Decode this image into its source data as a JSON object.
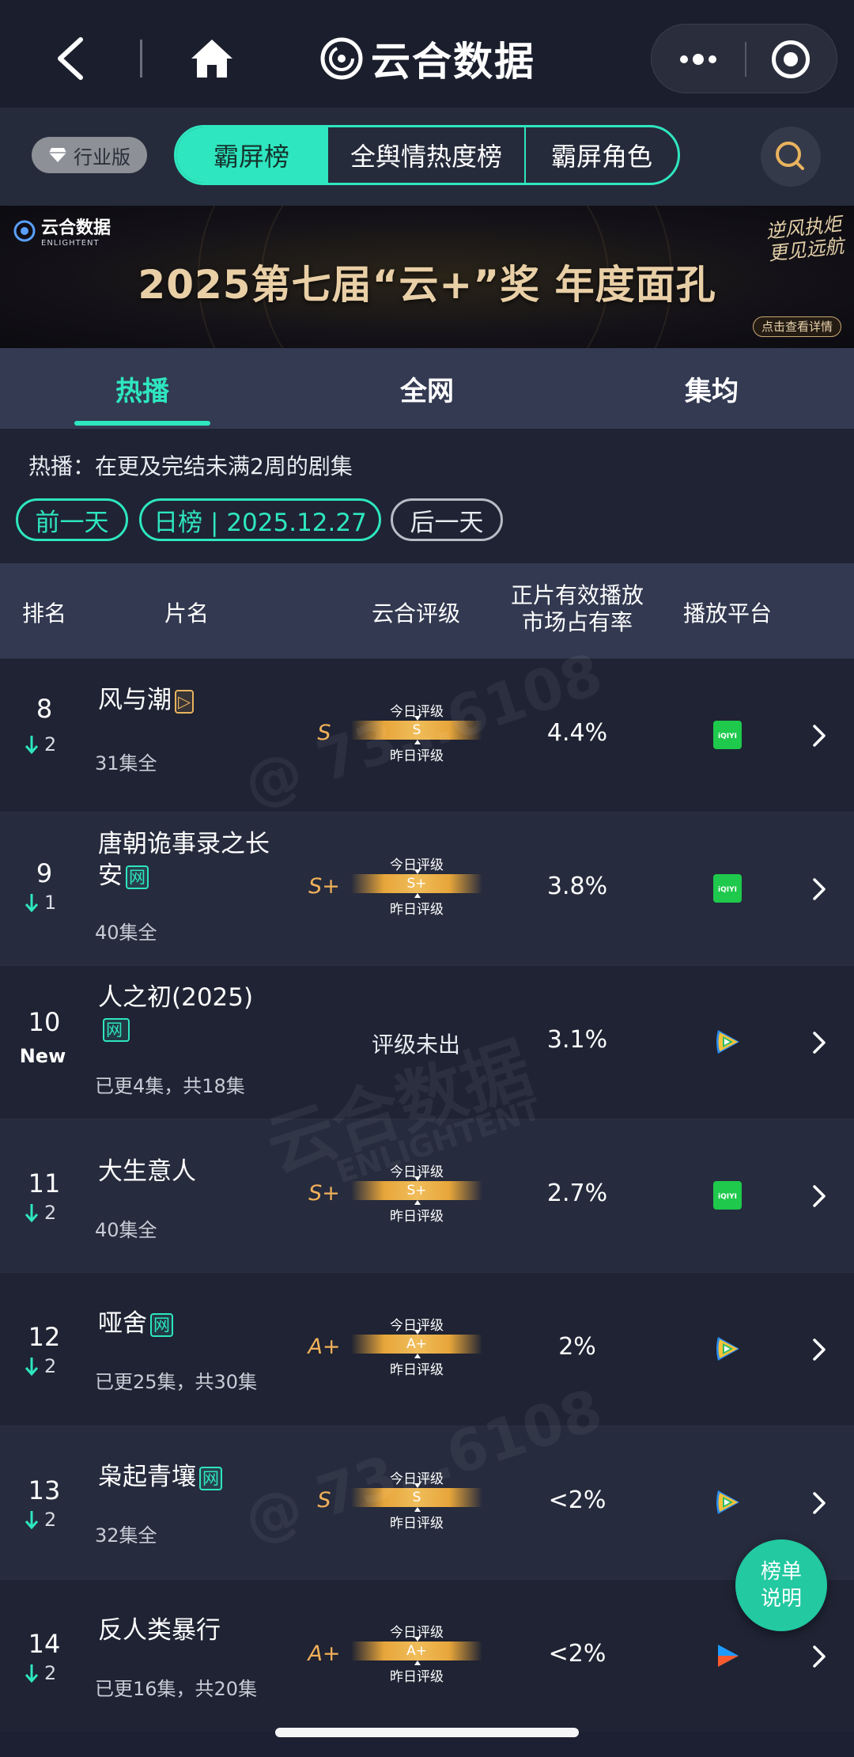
{
  "nav": {
    "brand": "云合数据"
  },
  "filter": {
    "edition_label": "行业版",
    "segments": [
      {
        "label": "霸屏榜",
        "active": true
      },
      {
        "label": "全舆情热度榜",
        "active": false
      },
      {
        "label": "霸屏角色",
        "active": false
      }
    ]
  },
  "banner": {
    "logo_name": "云合数据",
    "logo_sub": "ENLIGHTENT",
    "title": "2025第七届“云+”奖  年度面孔",
    "script_line1": "逆风执炬",
    "script_line2": "更见远航",
    "cta": "点击查看详情"
  },
  "tabs": [
    {
      "label": "热播",
      "active": true
    },
    {
      "label": "全网",
      "active": false
    },
    {
      "label": "集均",
      "active": false
    }
  ],
  "desc": "热播：在更及完结未满2周的剧集",
  "date_controls": {
    "prev": "前一天",
    "current": "日榜 | 2025.12.27",
    "next": "后一天"
  },
  "table_header": {
    "rank": "排名",
    "title": "片名",
    "grade": "云合评级",
    "share_line1": "正片有效播放",
    "share_line2": "市场占有率",
    "platform": "播放平台"
  },
  "grade_labels": {
    "today": "今日评级",
    "yesterday": "昨日评级",
    "none": "评级未出"
  },
  "rows": [
    {
      "rank": "8",
      "change": "2",
      "direction": "down",
      "title": "风与潮",
      "tag": "play",
      "sub": "31集全",
      "grade": "S",
      "grade_today": "S",
      "share": "4.4%",
      "platform": "iqiyi"
    },
    {
      "rank": "9",
      "change": "1",
      "direction": "down",
      "title": "唐朝诡事录之长安",
      "tag": "网",
      "sub": "40集全",
      "grade": "S+",
      "grade_today": "S+",
      "share": "3.8%",
      "platform": "iqiyi"
    },
    {
      "rank": "10",
      "change": "New",
      "direction": "new",
      "title": "人之初(2025)",
      "tag": "网",
      "sub": "已更4集，共18集",
      "grade": "",
      "grade_today": "",
      "share": "3.1%",
      "platform": "tencent"
    },
    {
      "rank": "11",
      "change": "2",
      "direction": "down",
      "title": "大生意人",
      "tag": "",
      "sub": "40集全",
      "grade": "S+",
      "grade_today": "S+",
      "share": "2.7%",
      "platform": "iqiyi"
    },
    {
      "rank": "12",
      "change": "2",
      "direction": "down",
      "title": "哑舍",
      "tag": "网",
      "sub": "已更25集，共30集",
      "grade": "A+",
      "grade_today": "A+",
      "share": "2%",
      "platform": "tencent"
    },
    {
      "rank": "13",
      "change": "2",
      "direction": "down",
      "title": "枭起青壤",
      "tag": "网",
      "sub": "32集全",
      "grade": "S",
      "grade_today": "S",
      "share": "<2%",
      "platform": "tencent"
    },
    {
      "rank": "14",
      "change": "2",
      "direction": "down",
      "title": "反人类暴行",
      "tag": "",
      "sub": "已更16集，共20集",
      "grade": "A+",
      "grade_today": "A+",
      "share": "<2%",
      "platform": "youku"
    }
  ],
  "float_help": {
    "line1": "榜单",
    "line2": "说明"
  },
  "watermark": {
    "text1": "@ 73…6108",
    "text2": "云合数据",
    "text3": "ENLIGHTENT"
  },
  "colors": {
    "accent": "#2ee6bf",
    "grade": "#f2b15a",
    "bg": "#1c2032",
    "iqiyi": "#1ec94c"
  }
}
